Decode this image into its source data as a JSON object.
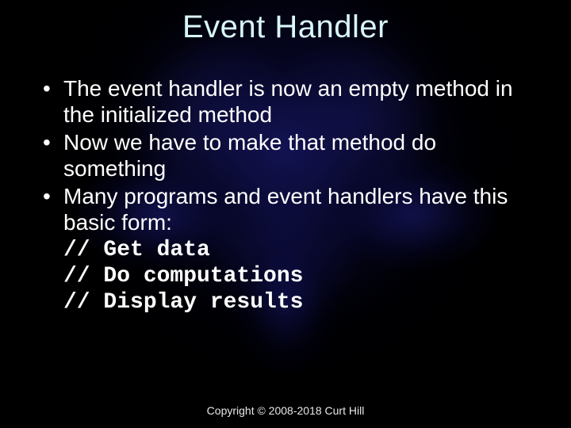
{
  "title": "Event Handler",
  "bullets": [
    "The event handler is now an empty method in the initialized method",
    "Now we have to make that method do something",
    "Many programs and event handlers have this basic form:"
  ],
  "code": "// Get data\n// Do computations\n// Display results",
  "footer": "Copyright © 2008-2018 Curt Hill"
}
